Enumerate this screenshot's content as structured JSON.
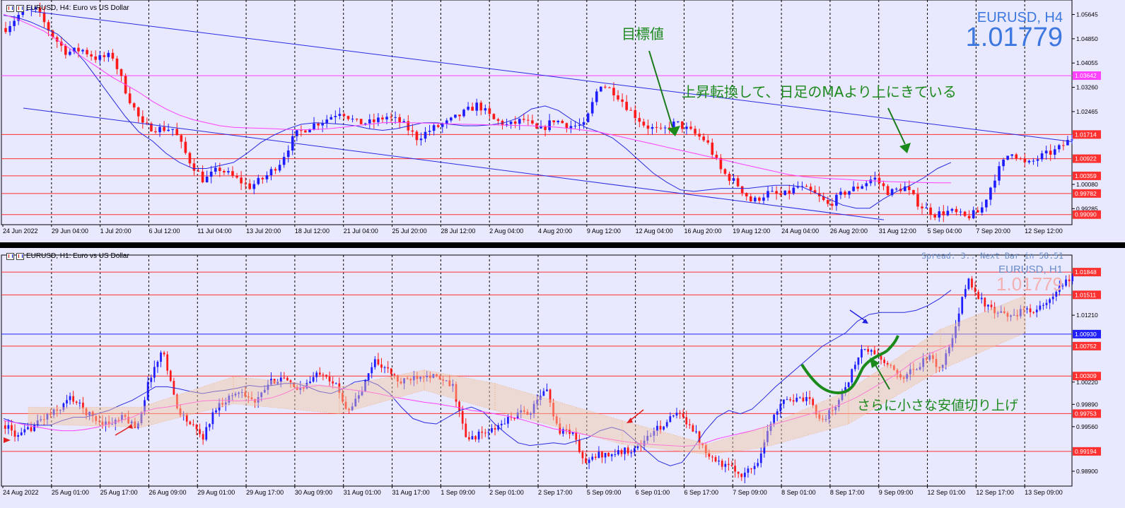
{
  "colors": {
    "background": "#e8e8ff",
    "bull": "#1d1dff",
    "bear": "#ff1a1a",
    "hline": "#ff3030",
    "magenta": "#ff40ff",
    "ma_blue": "#2a2ae0",
    "green_text": "#1e8a1e",
    "symbol_blue": "#3c78e0"
  },
  "chart_data": [
    {
      "type": "candlestick",
      "title": "EURUSD, H4: Euro vs US Dollar",
      "symbol_label": "EURUSD, H4",
      "price_label": "1.01779",
      "y_ticks": [
        "1.05645",
        "1.04850",
        "1.04055",
        "1.03260",
        "1.02465",
        "1.00080",
        "0.99285"
      ],
      "ylim": [
        0.9876,
        1.0612
      ],
      "x_ticks": [
        "24 Jun 2022",
        "29 Jun 04:00",
        "1 Jul 20:00",
        "6 Jul 12:00",
        "11 Jul 04:00",
        "13 Jul 20:00",
        "18 Jul 12:00",
        "21 Jul 04:00",
        "25 Jul 20:00",
        "28 Jul 12:00",
        "2 Aug 04:00",
        "4 Aug 20:00",
        "9 Aug 12:00",
        "12 Aug 04:00",
        "16 Aug 20:00",
        "19 Aug 12:00",
        "24 Aug 04:00",
        "26 Aug 20:00",
        "31 Aug 12:00",
        "5 Sep 04:00",
        "7 Sep 20:00",
        "12 Sep 12:00"
      ],
      "price_path": [
        1.052,
        1.057,
        1.058,
        1.05,
        1.044,
        1.045,
        1.042,
        1.043,
        1.03,
        1.02,
        1.019,
        1.019,
        1.009,
        1.002,
        1.006,
        1.003,
        1.0,
        1.003,
        1.008,
        1.017,
        1.02,
        1.022,
        1.025,
        1.021,
        1.021,
        1.023,
        1.021,
        1.016,
        1.019,
        1.021,
        1.024,
        1.027,
        1.022,
        1.02,
        1.022,
        1.018,
        1.022,
        1.02,
        1.02,
        1.034,
        1.031,
        1.025,
        1.02,
        1.018,
        1.021,
        1.018,
        1.015,
        1.005,
        1.001,
        0.995,
        0.998,
        0.997,
        1.0,
        0.998,
        0.994,
        0.998,
        1.0,
        1.003,
        0.998,
        1.0,
        0.994,
        0.991,
        0.992,
        0.99,
        0.992,
        1.004,
        1.012,
        1.007,
        1.01,
        1.012,
        1.016
      ],
      "series": [
        {
          "name": "",
          "values": [
            1.0562,
            1.0555,
            1.054,
            1.052,
            1.05,
            1.046,
            1.041,
            1.035,
            1.029,
            1.023,
            1.018,
            1.015,
            1.011,
            1.008,
            1.006,
            1.006,
            1.007,
            1.008,
            1.011,
            1.0145,
            1.017,
            1.019,
            1.0205,
            1.021,
            1.0208,
            1.0205,
            1.02,
            1.019,
            1.0185,
            1.019,
            1.02,
            1.021,
            1.021,
            1.0205,
            1.02,
            1.02,
            1.0203,
            1.021,
            1.0225,
            1.0255,
            1.0265,
            1.025,
            1.022,
            1.0195,
            1.018,
            1.016,
            1.0125,
            1.0085,
            1.0045,
            1.0015,
            0.999,
            0.9985,
            0.999,
            0.9995,
            0.9995,
            0.9995,
            1.0,
            1.0005,
            1.0005,
            1.0,
            0.998,
            0.996,
            0.994,
            0.993,
            0.993,
            0.996,
            0.9985,
            1.0005,
            1.003,
            1.006,
            1.008
          ]
        },
        {
          "name": "",
          "values": [
            1.0565,
            1.055,
            1.053,
            1.051,
            1.048,
            1.045,
            1.042,
            1.039,
            1.036,
            1.0335,
            1.031,
            1.028,
            1.0255,
            1.0235,
            1.022,
            1.021,
            1.02,
            1.0195,
            1.0193,
            1.0192,
            1.019,
            1.0188,
            1.0187,
            1.0188,
            1.019,
            1.0195,
            1.02,
            1.0205,
            1.021,
            1.0211,
            1.021,
            1.0209,
            1.0208,
            1.0206,
            1.0205,
            1.0204,
            1.0203,
            1.0202,
            1.0201,
            1.02,
            1.0198,
            1.0195,
            1.019,
            1.0185,
            1.018,
            1.017,
            1.016,
            1.015,
            1.014,
            1.013,
            1.012,
            1.011,
            1.01,
            1.009,
            1.008,
            1.007,
            1.006,
            1.005,
            1.004,
            1.0034,
            1.003,
            1.0027,
            1.0025,
            1.0022,
            1.002,
            1.0018,
            1.0016,
            1.0015,
            1.0014,
            1.0013,
            1.0013
          ]
        }
      ],
      "horizontal_lines": [
        {
          "price": 1.03642,
          "label": "1.03642",
          "color": "magenta"
        },
        {
          "price": 1.01714,
          "label": "1.01714",
          "color": "red"
        },
        {
          "price": 1.00922,
          "label": "1.00922",
          "color": "red"
        },
        {
          "price": 1.00359,
          "label": "1.00359",
          "color": "red"
        },
        {
          "price": 0.99782,
          "label": "0.99782",
          "color": "red"
        },
        {
          "price": 0.9909,
          "label": "0.99090",
          "color": "red"
        }
      ],
      "annotations": [
        "目標値",
        "上昇転換して、日足のMAより上にきている"
      ]
    },
    {
      "type": "candlestick",
      "title": "EURUSD, H1: Euro vs US Dollar",
      "symbol_label": "EURUSD, H1",
      "price_label": "1.01779",
      "info_text": "Spread: 3.. Next Bar in 58:51",
      "y_ticks": [
        "1.01210",
        "1.00220",
        "0.99890",
        "0.99560",
        "0.98900"
      ],
      "ylim": [
        0.9868,
        1.021
      ],
      "x_ticks": [
        "24 Aug 2022",
        "25 Aug 01:00",
        "25 Aug 17:00",
        "26 Aug 09:00",
        "29 Aug 01:00",
        "29 Aug 17:00",
        "30 Aug 09:00",
        "31 Aug 01:00",
        "31 Aug 17:00",
        "1 Sep 09:00",
        "2 Sep 01:00",
        "2 Sep 17:00",
        "5 Sep 09:00",
        "6 Sep 01:00",
        "6 Sep 17:00",
        "7 Sep 09:00",
        "8 Sep 01:00",
        "8 Sep 17:00",
        "9 Sep 09:00",
        "12 Sep 01:00",
        "12 Sep 17:00",
        "13 Sep 09:00"
      ],
      "price_path": [
        0.9958,
        0.994,
        0.9955,
        0.997,
        0.998,
        1.0,
        0.998,
        0.9965,
        0.996,
        0.997,
        0.9955,
        1.003,
        1.007,
        0.9985,
        0.996,
        0.994,
        0.9985,
        1.0,
        1.001,
        0.999,
        1.002,
        1.003,
        1.001,
        1.002,
        1.004,
        1.002,
        0.998,
        1.0005,
        1.0055,
        1.004,
        1.002,
        1.003,
        1.0035,
        1.0025,
        1.0015,
        0.9935,
        0.9945,
        0.995,
        0.9965,
        0.9975,
        0.998,
        1.0015,
        0.995,
        0.995,
        0.99,
        0.9915,
        0.9915,
        0.992,
        0.9925,
        0.9945,
        0.996,
        0.9975,
        0.996,
        0.9925,
        0.9905,
        0.9895,
        0.9885,
        0.99,
        0.9955,
        1.0,
        0.9995,
        0.9995,
        0.9965,
        0.9985,
        1.0025,
        1.007,
        1.0065,
        1.0045,
        1.003,
        1.004,
        1.006,
        1.0042,
        1.009,
        1.0175,
        1.0145,
        1.0125,
        1.012,
        1.0125,
        1.013,
        1.0135,
        1.016,
        1.0178
      ],
      "series": [
        {
          "name": "",
          "values": [
            0.9968,
            0.9962,
            0.996,
            0.9958,
            0.9958,
            0.9965,
            0.997,
            0.997,
            0.9975,
            0.998,
            0.9988,
            0.9995,
            1.0005,
            1.0015,
            1.0015,
            1.0012,
            1.0008,
            1.0005,
            1.0008,
            1.001,
            1.0013,
            1.0017,
            1.0015,
            1.0017,
            1.002,
            1.002,
            1.0015,
            1.0008,
            1.0005,
            1.0012,
            1.0022,
            1.0025,
            1.0018,
            1.0005,
            0.9985,
            0.9968,
            0.9962,
            0.996,
            0.997,
            0.998,
            0.9985,
            0.9978,
            0.996,
            0.9945,
            0.9932,
            0.9928,
            0.993,
            0.9932,
            0.993,
            0.9935,
            0.994,
            0.995,
            0.9955,
            0.995,
            0.9935,
            0.992,
            0.9905,
            0.9898,
            0.9903,
            0.9925,
            0.995,
            0.997,
            0.998,
            0.9975,
            0.9982,
            0.9998,
            1.0015,
            1.003,
            1.0045,
            1.006,
            1.0075,
            1.0085,
            1.0095,
            1.0112,
            1.0122,
            1.0125,
            1.0125,
            1.0125,
            1.0128,
            1.0135,
            1.0145,
            1.0158
          ]
        },
        {
          "name": "",
          "values": [
            0.9965,
            0.9962,
            0.9958,
            0.9955,
            0.9952,
            0.995,
            0.995,
            0.9952,
            0.9955,
            0.996,
            0.9965,
            0.997,
            0.9978,
            0.9983,
            0.9985,
            0.9988,
            0.9991,
            0.9994,
            0.9995,
            0.9995,
            0.9994,
            0.9995,
            0.9996,
            0.9999,
            1.0005,
            1.0013,
            1.0015,
            1.0017,
            1.0015,
            1.0012,
            1.001,
            1.0008,
            1.0005,
            1.0001,
            0.9998,
            0.9995,
            0.9992,
            0.999,
            0.9987,
            0.9984,
            0.998,
            0.9978,
            0.9975,
            0.9972,
            0.9968,
            0.9963,
            0.9958,
            0.9953,
            0.995,
            0.9947,
            0.9943,
            0.994,
            0.9937,
            0.9934,
            0.9932,
            0.993,
            0.9929,
            0.9928,
            0.9927,
            0.9928,
            0.9932,
            0.9938,
            0.9942,
            0.9946,
            0.995,
            0.9955,
            0.996,
            0.9965,
            0.997,
            0.9975,
            0.998,
            0.9985,
            0.9992,
            1.0,
            1.001,
            1.002,
            1.003,
            1.0042,
            1.0055,
            1.0063,
            1.007,
            1.0078
          ]
        }
      ],
      "horizontal_lines": [
        {
          "price": 1.01848,
          "label": "1.01848",
          "color": "red"
        },
        {
          "price": 1.01511,
          "label": "1.01511",
          "color": "red"
        },
        {
          "price": 1.0093,
          "label": "1.00930",
          "color": "blue"
        },
        {
          "price": 1.00752,
          "label": "1.00752",
          "color": "red"
        },
        {
          "price": 1.00309,
          "label": "1.00309",
          "color": "red"
        },
        {
          "price": 0.99753,
          "label": "0.99753",
          "color": "red"
        },
        {
          "price": 0.99194,
          "label": "0.99194",
          "color": "red"
        }
      ],
      "annotations": [
        "さらに小さな安値切り上げ"
      ]
    }
  ]
}
